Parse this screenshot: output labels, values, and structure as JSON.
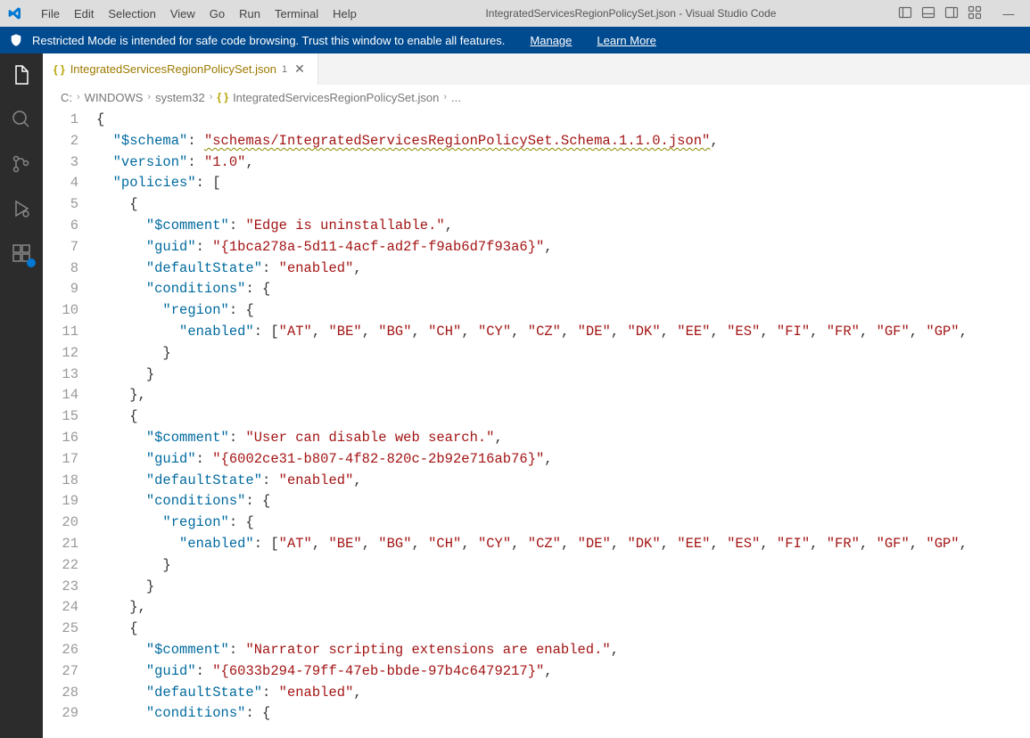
{
  "titlebar": {
    "menu": [
      "File",
      "Edit",
      "Selection",
      "View",
      "Go",
      "Run",
      "Terminal",
      "Help"
    ],
    "title": "IntegratedServicesRegionPolicySet.json - Visual Studio Code"
  },
  "bluebar": {
    "message": "Restricted Mode is intended for safe code browsing. Trust this window to enable all features.",
    "manage": "Manage",
    "learn": "Learn More"
  },
  "tab": {
    "name": "IntegratedServicesRegionPolicySet.json",
    "dirty": "1"
  },
  "breadcrumb": {
    "parts": [
      "C:",
      "WINDOWS",
      "system32",
      "IntegratedServicesRegionPolicySet.json",
      "..."
    ]
  },
  "line_numbers": [
    "1",
    "2",
    "3",
    "4",
    "5",
    "6",
    "7",
    "8",
    "9",
    "10",
    "11",
    "12",
    "13",
    "14",
    "15",
    "16",
    "17",
    "18",
    "19",
    "20",
    "21",
    "22",
    "23",
    "24",
    "25",
    "26",
    "27",
    "28",
    "29"
  ],
  "json": {
    "schema_key": "\"$schema\"",
    "schema_val": "\"schemas/IntegratedServicesRegionPolicySet.Schema.1.1.0.json\"",
    "version_key": "\"version\"",
    "version_val": "\"1.0\"",
    "policies_key": "\"policies\"",
    "comment_key": "\"$comment\"",
    "guid_key": "\"guid\"",
    "default_key": "\"defaultState\"",
    "enabled_val": "\"enabled\"",
    "cond_key": "\"conditions\"",
    "region_key": "\"region\"",
    "enabled_key": "\"enabled\"",
    "p1_comment": "\"Edge is uninstallable.\"",
    "p1_guid": "\"{1bca278a-5d11-4acf-ad2f-f9ab6d7f93a6}\"",
    "p2_comment": "\"User can disable web search.\"",
    "p2_guid": "\"{6002ce31-b807-4f82-820c-2b92e716ab76}\"",
    "p3_comment": "\"Narrator scripting extensions are enabled.\"",
    "p3_guid": "\"{6033b294-79ff-47eb-bbde-97b4c6479217}\"",
    "regions": [
      "\"AT\"",
      "\"BE\"",
      "\"BG\"",
      "\"CH\"",
      "\"CY\"",
      "\"CZ\"",
      "\"DE\"",
      "\"DK\"",
      "\"EE\"",
      "\"ES\"",
      "\"FI\"",
      "\"FR\"",
      "\"GF\"",
      "\"GP\""
    ]
  }
}
